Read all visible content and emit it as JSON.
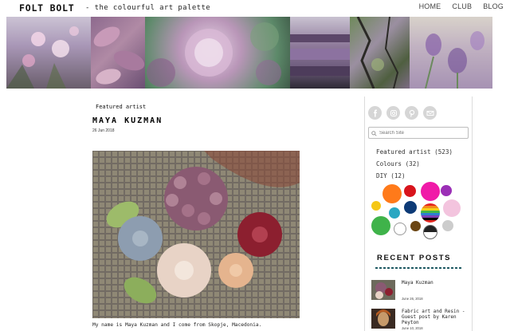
{
  "header": {
    "logo": "FOLT BOLT",
    "tagline": "- the colourful art palette",
    "nav": [
      "HOME",
      "CLUB",
      "BLOG"
    ]
  },
  "post": {
    "category": "Featured artist",
    "title": "MAYA KUZMAN",
    "date": "26 Jun 2018",
    "excerpt": "My name is Maya Kuzman and I come from Skopje, Macedonia."
  },
  "sidebar": {
    "search_placeholder": "Search Site",
    "categories": [
      {
        "label": "Featured artist (523)"
      },
      {
        "label": "Colours (32)"
      },
      {
        "label": "DIY (12)"
      }
    ],
    "palette_colors": [
      "#ff7a1a",
      "#d8141c",
      "#f01aa8",
      "#9b2fb6",
      "#f5c716",
      "#2aa7c2",
      "#0d3a76",
      "#f3c4de",
      "#3fb34a",
      "#ffffff",
      "#6b4513",
      "#222222",
      "#cccccc"
    ],
    "recent_title": "RECENT POSTS",
    "recent_posts": [
      {
        "title": "Maya Kuzman",
        "date": "June 26, 2018"
      },
      {
        "title": "Fabric art and Resin - Guest post by Karen Peyton",
        "date": "June 10, 2018"
      }
    ]
  },
  "icons": [
    "facebook-icon",
    "instagram-icon",
    "pinterest-icon",
    "email-icon",
    "search-icon"
  ]
}
